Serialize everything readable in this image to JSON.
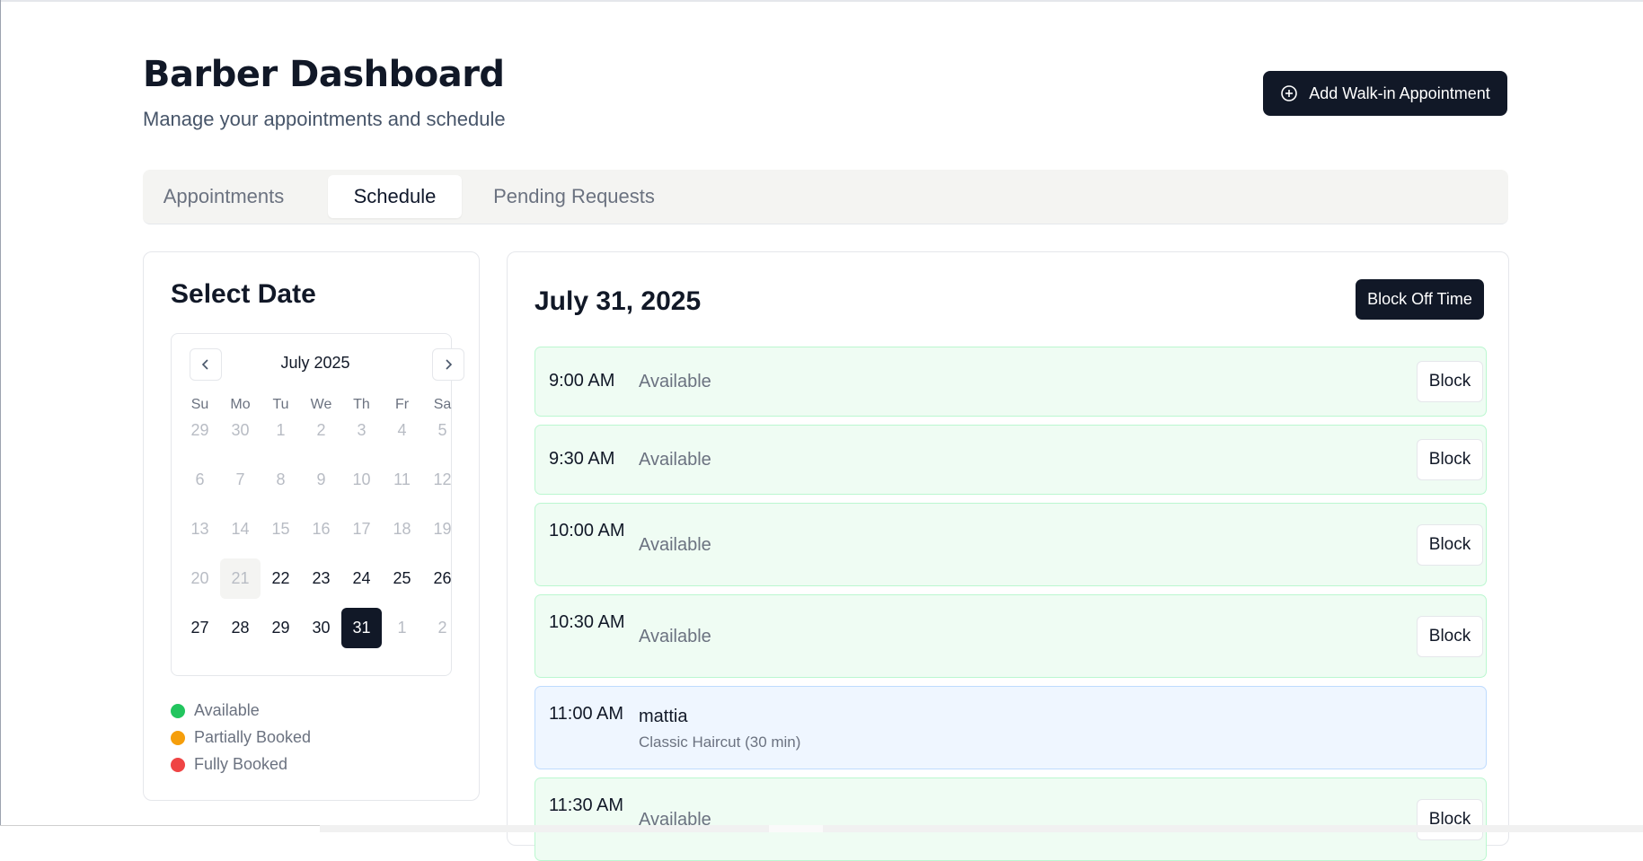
{
  "header": {
    "title": "Barber Dashboard",
    "subtitle": "Manage your appointments and schedule",
    "walkin_label": "Add Walk-in Appointment"
  },
  "tabs": [
    {
      "label": "Appointments",
      "active": false
    },
    {
      "label": "Schedule",
      "active": true
    },
    {
      "label": "Pending Requests",
      "active": false
    }
  ],
  "calendar": {
    "title": "Select Date",
    "month": "July 2025",
    "weekdays": [
      "Su",
      "Mo",
      "Tu",
      "We",
      "Th",
      "Fr",
      "Sa"
    ],
    "weeks": [
      [
        {
          "d": "29",
          "s": "muted"
        },
        {
          "d": "30",
          "s": "muted"
        },
        {
          "d": "1",
          "s": "muted"
        },
        {
          "d": "2",
          "s": "muted"
        },
        {
          "d": "3",
          "s": "muted"
        },
        {
          "d": "4",
          "s": "muted"
        },
        {
          "d": "5",
          "s": "muted"
        }
      ],
      [
        {
          "d": "6",
          "s": "muted"
        },
        {
          "d": "7",
          "s": "muted"
        },
        {
          "d": "8",
          "s": "muted"
        },
        {
          "d": "9",
          "s": "muted"
        },
        {
          "d": "10",
          "s": "muted"
        },
        {
          "d": "11",
          "s": "muted"
        },
        {
          "d": "12",
          "s": "muted"
        }
      ],
      [
        {
          "d": "13",
          "s": "muted"
        },
        {
          "d": "14",
          "s": "muted"
        },
        {
          "d": "15",
          "s": "muted"
        },
        {
          "d": "16",
          "s": "muted"
        },
        {
          "d": "17",
          "s": "muted"
        },
        {
          "d": "18",
          "s": "muted"
        },
        {
          "d": "19",
          "s": "muted"
        }
      ],
      [
        {
          "d": "20",
          "s": "muted"
        },
        {
          "d": "21",
          "s": "today"
        },
        {
          "d": "22",
          "s": "active"
        },
        {
          "d": "23",
          "s": "active"
        },
        {
          "d": "24",
          "s": "active"
        },
        {
          "d": "25",
          "s": "active"
        },
        {
          "d": "26",
          "s": "active"
        }
      ],
      [
        {
          "d": "27",
          "s": "active"
        },
        {
          "d": "28",
          "s": "active"
        },
        {
          "d": "29",
          "s": "active"
        },
        {
          "d": "30",
          "s": "active"
        },
        {
          "d": "31",
          "s": "selected"
        },
        {
          "d": "1",
          "s": "muted"
        },
        {
          "d": "2",
          "s": "muted"
        }
      ]
    ],
    "legend": [
      {
        "label": "Available",
        "color": "#22c55e"
      },
      {
        "label": "Partially Booked",
        "color": "#f59e0b"
      },
      {
        "label": "Fully Booked",
        "color": "#ef4444"
      }
    ]
  },
  "schedule": {
    "date": "July 31, 2025",
    "block_off_label": "Block Off Time",
    "block_label": "Block",
    "slots": [
      {
        "time": "9:00 AM",
        "type": "available",
        "status": "Available"
      },
      {
        "time": "9:30 AM",
        "type": "available",
        "status": "Available"
      },
      {
        "time": "10:00 AM",
        "type": "available",
        "status": "Available"
      },
      {
        "time": "10:30 AM",
        "type": "available",
        "status": "Available"
      },
      {
        "time": "11:00 AM",
        "type": "booked",
        "client": "mattia",
        "service": "Classic Haircut (30 min)"
      },
      {
        "time": "11:30 AM",
        "type": "available",
        "status": "Available"
      }
    ]
  }
}
